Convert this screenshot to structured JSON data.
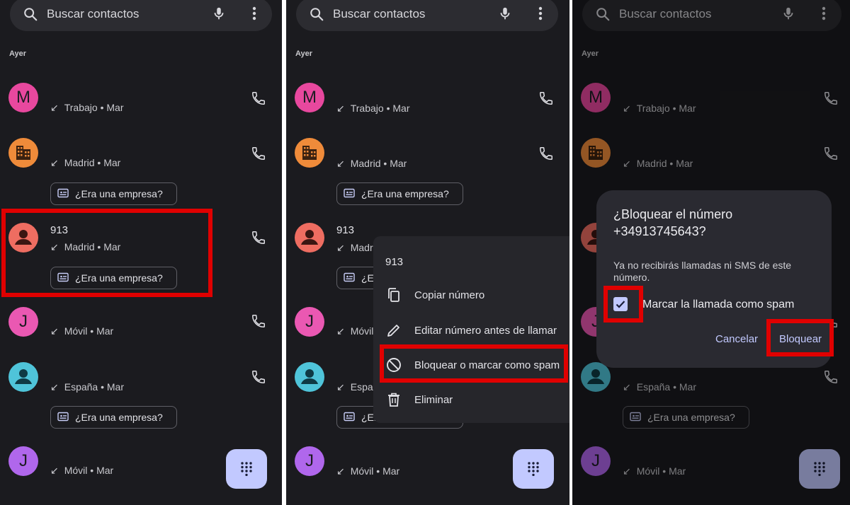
{
  "search": {
    "placeholder": "Buscar contactos"
  },
  "section_label": "Ayer",
  "contacts": [
    {
      "initial": "M",
      "color": "#e8489e",
      "detail": "Trabajo • Mar"
    },
    {
      "initial": "",
      "icon": "building-icon",
      "color": "#ef8b3a",
      "detail": "Madrid • Mar",
      "chip": "¿Era una empresa?"
    },
    {
      "number": "913",
      "icon": "person-icon",
      "color": "#ee6d61",
      "detail": "Madrid • Mar",
      "chip": "¿Era una empresa?"
    },
    {
      "initial": "J",
      "color": "#ea58b2",
      "detail": "Móvil • Mar"
    },
    {
      "icon": "person-icon",
      "color": "#4fc4d9",
      "detail": "España • Mar",
      "chip": "¿Era una empresa?"
    },
    {
      "initial": "J",
      "color": "#b067ec",
      "detail": "Móvil • Mar"
    }
  ],
  "menu": {
    "title": "913",
    "items": [
      "Copiar número",
      "Editar número antes de llamar",
      "Bloquear o marcar como spam",
      "Eliminar"
    ]
  },
  "dialog": {
    "title": "¿Bloquear el número +34913745643?",
    "body": "Ya no recibirás llamadas ni SMS de este número.",
    "checkbox_label": "Marcar la llamada como spam",
    "checked": true,
    "cancel": "Cancelar",
    "confirm": "Bloquear"
  },
  "colors": {
    "background": "#1b1b1f",
    "highlight": "#e00000",
    "accent": "#c2c9ff"
  }
}
